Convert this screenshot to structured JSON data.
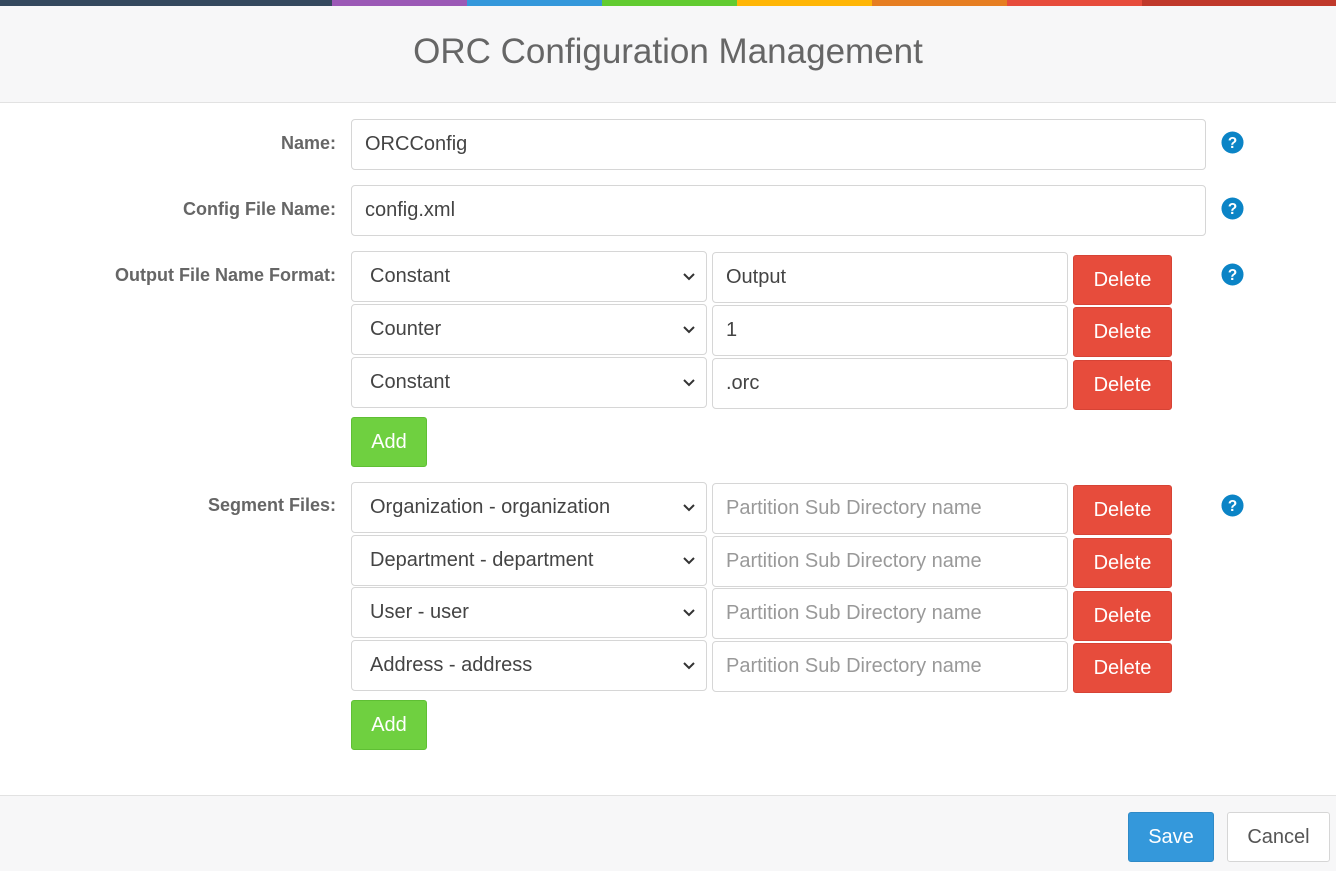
{
  "title": "ORC Configuration Management",
  "colors": {
    "stripe": [
      "#34495e",
      "#9b59b6",
      "#3498db",
      "#62cb31",
      "#ffb606",
      "#e67e22",
      "#e74c3c",
      "#c0392b"
    ],
    "delete": "#e74c3c",
    "add": "#6fd040",
    "save": "#3498db",
    "help": "#0b84c6"
  },
  "name": {
    "label": "Name:",
    "value": "ORCConfig"
  },
  "config_file": {
    "label": "Config File Name:",
    "value": "config.xml"
  },
  "output_format": {
    "label": "Output File Name Format:",
    "rows": [
      {
        "type": "Constant",
        "value": "Output",
        "delete_label": "Delete"
      },
      {
        "type": "Counter",
        "value": "1",
        "delete_label": "Delete"
      },
      {
        "type": "Constant",
        "value": ".orc",
        "delete_label": "Delete"
      }
    ],
    "add_label": "Add"
  },
  "segment_files": {
    "label": "Segment Files:",
    "rows": [
      {
        "type": "Organization - organization",
        "placeholder": "Partition Sub Directory name",
        "delete_label": "Delete"
      },
      {
        "type": "Department - department",
        "placeholder": "Partition Sub Directory name",
        "delete_label": "Delete"
      },
      {
        "type": "User - user",
        "placeholder": "Partition Sub Directory name",
        "delete_label": "Delete"
      },
      {
        "type": "Address - address",
        "placeholder": "Partition Sub Directory name",
        "delete_label": "Delete"
      }
    ],
    "add_label": "Add"
  },
  "footer": {
    "save_label": "Save",
    "cancel_label": "Cancel"
  },
  "icons": {
    "help": "question-circle-icon",
    "select_arrow": "chevron-down-icon"
  }
}
